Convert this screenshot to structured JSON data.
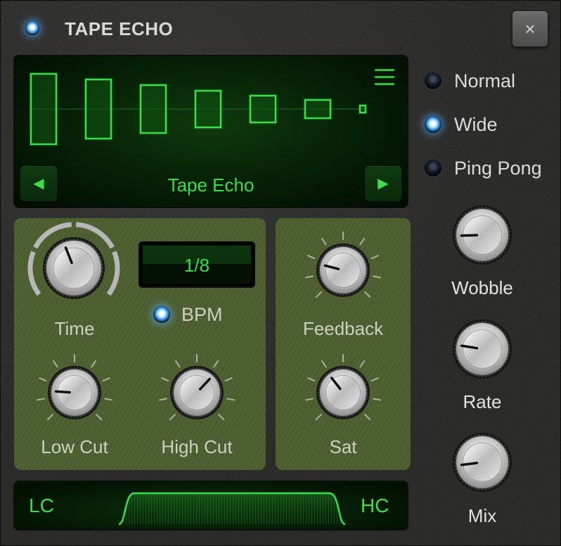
{
  "header": {
    "title": "TAPE ECHO",
    "close_label": "×"
  },
  "display": {
    "preset_name": "Tape Echo",
    "prev_label": "◀",
    "next_label": "▶",
    "echo_levels": [
      1.0,
      0.84,
      0.68,
      0.52,
      0.38,
      0.26,
      0.1
    ]
  },
  "modes": [
    {
      "label": "Normal",
      "selected": false
    },
    {
      "label": "Wide",
      "selected": true
    },
    {
      "label": "Ping Pong",
      "selected": false
    }
  ],
  "time_section": {
    "time_label": "Time",
    "time_value": "1/8",
    "bpm_label": "BPM",
    "bpm_on": true,
    "low_cut_label": "Low Cut",
    "high_cut_label": "High Cut"
  },
  "feedback_section": {
    "feedback_label": "Feedback",
    "sat_label": "Sat"
  },
  "right_knobs": {
    "wobble_label": "Wobble",
    "rate_label": "Rate",
    "mix_label": "Mix"
  },
  "knob_values": {
    "time": 0.42,
    "low_cut": 0.18,
    "high_cut": 0.66,
    "feedback": 0.22,
    "sat": 0.36,
    "wobble": 0.16,
    "rate": 0.2,
    "mix": 0.14
  },
  "filter": {
    "lc_label": "LC",
    "hc_label": "HC"
  },
  "colors": {
    "lcd_green": "#3ddc4a",
    "panel_green": "#4d5f30",
    "led_blue": "#2b82cf"
  }
}
